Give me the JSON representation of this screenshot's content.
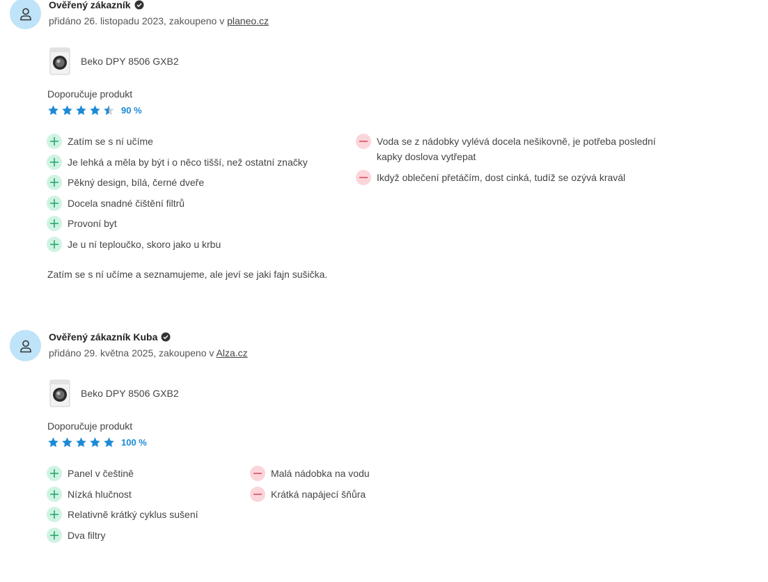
{
  "reviews": [
    {
      "author": "Ověřený zákazník",
      "meta_prefix": "přidáno 26. listopadu 2023, zakoupeno v ",
      "shop": "planeo.cz",
      "product": "Beko DPY 8506 GXB2",
      "recommend_label": "Doporučuje produkt",
      "rating_pct": "90 %",
      "rating_value": 4.5,
      "pros": [
        "Zatím se s ní učíme",
        "Je lehká a měla by být i o něco tišší, než ostatní značky",
        "Pěkný design, bílá, černé dveře",
        "Docela snadné čištění filtrů",
        "Provoní byt",
        "Je u ní teploučko, skoro jako u krbu"
      ],
      "cons": [
        "Voda se z nádobky vylévá docela nešikovně, je potřeba poslední kapky doslova vytřepat",
        "Ikdyž oblečení přetáčím, dost cinká, tudíž se ozývá kravál"
      ],
      "text": "Zatím se s ní učíme a seznamujeme, ale jeví se jaki fajn sušička."
    },
    {
      "author": "Ověřený zákazník Kuba",
      "meta_prefix": "přidáno 29. května 2025, zakoupeno v ",
      "shop": "Alza.cz",
      "product": "Beko DPY 8506 GXB2",
      "recommend_label": "Doporučuje produkt",
      "rating_pct": "100 %",
      "rating_value": 5,
      "pros": [
        "Panel v češtině",
        "Nízká hlučnost",
        "Relativně krátký cyklus sušení",
        "Dva filtry"
      ],
      "cons": [
        "Malá nádobka na vodu",
        "Krátká napájecí šňůra"
      ]
    }
  ],
  "colors": {
    "avatar_bg": "#bfe3f8",
    "star": "#1c8ad6",
    "star_empty": "#d4d4d4",
    "plus_bg": "#cff3e3",
    "plus_fg": "#1fa36a",
    "minus_bg": "#fbd5da",
    "minus_fg": "#d6455b"
  },
  "icons": [
    "user-icon",
    "verified-check-icon",
    "star-icon",
    "plus-icon",
    "minus-icon"
  ]
}
